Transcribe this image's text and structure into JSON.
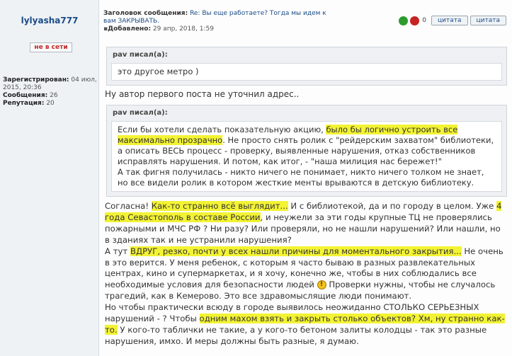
{
  "author": {
    "username": "lylyasha777",
    "status": "не в сети",
    "registered_label": "Зарегистрирован:",
    "registered_value": "04 июл, 2015, 20:36",
    "posts_label": "Сообщения:",
    "posts_value": "26",
    "rep_label": "Репутация:",
    "rep_value": "20"
  },
  "post": {
    "subject_label": "Заголовок сообщения:",
    "subject": "Re: Вы еще работаете? Тогда мы идем к вам ЗАКРЫВАТЬ.",
    "added_label": "Добавлено:",
    "added": "29 апр, 2018, 1:59",
    "rating_count": "0",
    "quote_button": "цитата",
    "quote_button2": "цитата"
  },
  "quote1": {
    "header": "pav писал(а):",
    "text": "это другое метро )"
  },
  "reply1": "Ну автор первого поста не уточнил адрес..",
  "quote2": {
    "header": "pav писал(а):",
    "t1": "Если бы хотели сделать показательную акцию, ",
    "t2": "было бы логично устроить все максимально прозрачно",
    "t3": ". Не просто снять ролик с \"рейдерским захватом\" библиотеки, а описать ВЕСЬ процесс - проверку, выявленные нарушения, отказ собственников исправлять нарушения. И потом, как итог, - \"наша милиция нас бережет!\"\nА так фигня получилась - никто ничего не понимает, никто ничего толком не знает, но все видели ролик в котором жесткие менты врываются в детскую библиотеку."
  },
  "reply2": {
    "s1": "Согласна! ",
    "s2": "Как-то странно всё выглядит...",
    "s3": " И с библиотекой, да и по городу в целом. Уже ",
    "s4": "4 года Севастополь в составе России",
    "s5": ", и неужели за эти годы крупные ТЦ не проверялись пожарными и МЧС РФ ? Ни разу? Или проверяли, но не нашли нарушений? Или нашли, но в зданиях так и не устранили нарушения?\nА тут ",
    "s6": "ВДРУГ, резко, почти у всех нашли причины для моментального закрытия...",
    "s7": " Не очень в это верится. У меня ребенок, с которым я часто бываю в разных развлекательных центрах, кино и супермаркетах, и я хочу, конечно же, чтобы в них соблюдались все необходимые условия для безопасности людей ",
    "s8": "!",
    "s9": " Проверки нужны, чтобы не случалось трагедий, как в Кемерово. Это все здравомыслящие люди понимают.\nНо чтобы практически всюду в городе выявилось неожиданно СТОЛЬКО СЕРЬЕЗНЫХ нарушений - ? Чтобы ",
    "s10": "одним махом взять и закрыть столько объектов? Хм, ну странно как-то.",
    "s11": " У кого-то таблички не такие, а у кого-то бетоном залиты колодцы - так это разные нарушения, имхо. И меры должны быть разные, я думаю."
  }
}
